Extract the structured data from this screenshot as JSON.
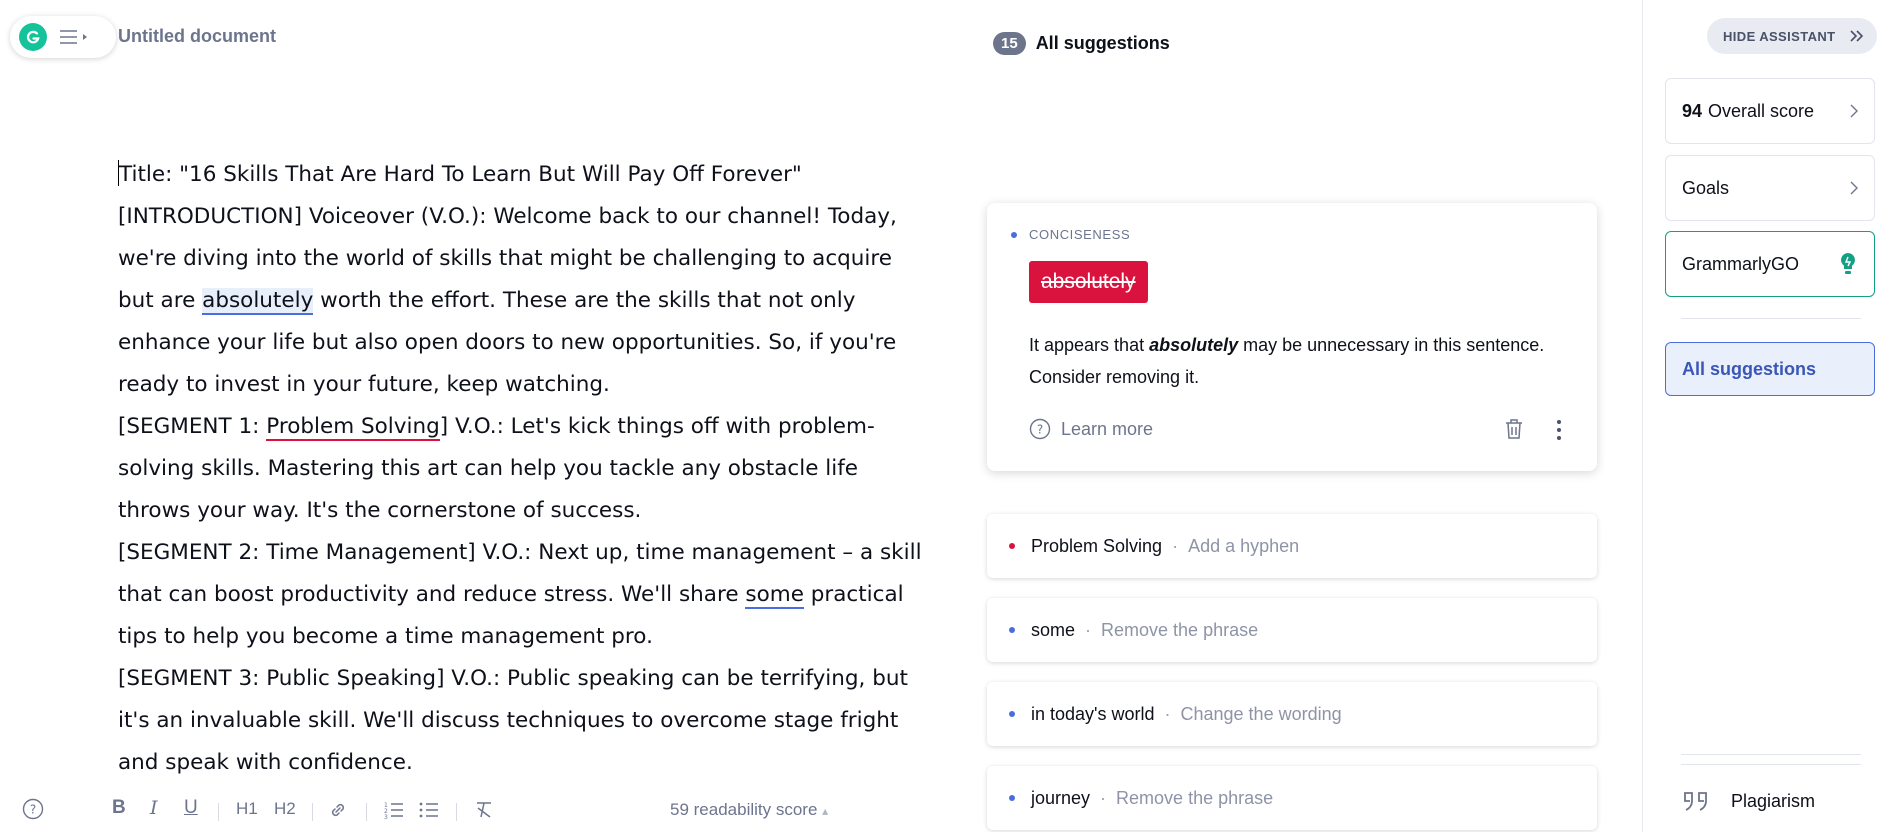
{
  "app": {
    "document_title": "Untitled document"
  },
  "editor": {
    "lines": [
      "Title: \"16 Skills That Are Hard To Learn But Will Pay Off Forever\"",
      "[INTRODUCTION] Voiceover (V.O.): Welcome back to our channel! Today,",
      "we're diving into the world of skills that might be challenging to acquire",
      "but are ",
      "absolutely",
      " worth the effort. These are the skills that not only",
      "enhance your life but also open doors to new opportunities. So, if you're",
      "ready to invest in your future, keep watching.",
      "[SEGMENT 1: ",
      "Problem Solving",
      "] V.O.: Let's kick things off with problem-",
      "solving skills. Mastering this art can help you tackle any obstacle life",
      "throws your way. It's the cornerstone of success.",
      "[SEGMENT 2: Time Management] V.O.: Next up, time management – a skill",
      "that can boost productivity and reduce stress. We'll share ",
      "some",
      " practical",
      "tips to help you become a time management pro.",
      "[SEGMENT 3: Public Speaking] V.O.: Public speaking can be terrifying, but",
      "it's an invaluable skill. We'll discuss techniques to overcome stage fright",
      "and speak with confidence."
    ]
  },
  "toolbar": {
    "bold": "B",
    "italic": "I",
    "underline": "U",
    "h1": "H1",
    "h2": "H2",
    "readability": "59 readability score",
    "readability_arrow": "▴",
    "icons": [
      "help-icon",
      "link-icon",
      "numbered-list-icon",
      "bullet-list-icon",
      "clear-format-icon"
    ]
  },
  "suggestions": {
    "count": "15",
    "title": "All suggestions",
    "active": {
      "category": "CONCISENESS",
      "word": "absolutely",
      "text_before": "It appears that ",
      "text_word": "absolutely",
      "text_after": " may be unnecessary in this sentence. Consider removing it.",
      "learn_more": "Learn more"
    },
    "items": [
      {
        "word": "Problem Solving",
        "sep": "·",
        "action": "Add a hyphen",
        "color": "#d9133d"
      },
      {
        "word": "some",
        "sep": "·",
        "action": "Remove the phrase",
        "color": "#4a6ee0"
      },
      {
        "word": "in today's world",
        "sep": "·",
        "action": "Change the wording",
        "color": "#4a6ee0"
      },
      {
        "word": "journey",
        "sep": "·",
        "action": "Remove the phrase",
        "color": "#4a6ee0"
      }
    ]
  },
  "sidebar": {
    "hide_assistant": "HIDE ASSISTANT",
    "overall_score_value": "94",
    "overall_score_label": "Overall score",
    "goals": "Goals",
    "grammarly_go": "GrammarlyGO",
    "all_suggestions": "All suggestions",
    "plagiarism": "Plagiarism"
  },
  "colors": {
    "brand": "#15c39a",
    "critical": "#d9133d",
    "clarity": "#4a6ee0"
  }
}
